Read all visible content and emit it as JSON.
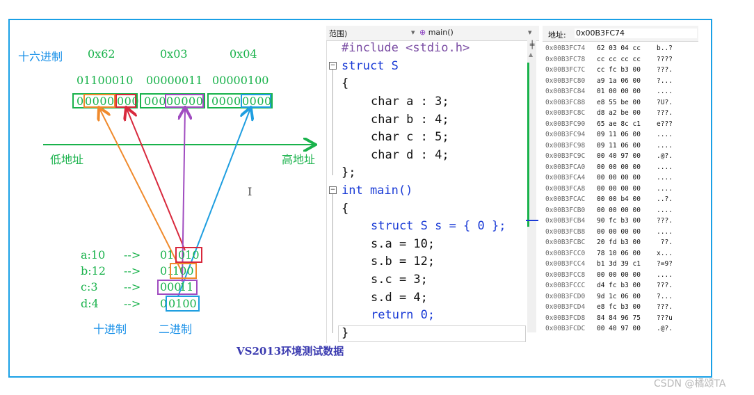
{
  "hex_label": "十六进制",
  "hex_values": [
    "0x62",
    "0x03",
    "0x04"
  ],
  "binary_bytes": [
    "01100010",
    "00000011",
    "00000100"
  ],
  "bit_groups": [
    {
      "a": "0",
      "b": "0000",
      "c": "000"
    },
    {
      "a": "000",
      "b": "00000"
    },
    {
      "a": "0000",
      "b": "0000"
    }
  ],
  "low_addr": "低地址",
  "high_addr": "高地址",
  "fields": [
    {
      "name": "a:10",
      "arrow": "-->",
      "pre": "01",
      "boxed": "010"
    },
    {
      "name": "b:12",
      "arrow": "-->",
      "pre": "01",
      "boxed": "100"
    },
    {
      "name": "c:3",
      "arrow": "-->",
      "pre": "000",
      "boxed": "11"
    },
    {
      "name": "d:4",
      "arrow": "-->",
      "pre": "0",
      "boxed": "0100"
    }
  ],
  "decimal_label": "十进制",
  "binary_label": "二进制",
  "caption": "VS2013环境测试数据",
  "cursor_glyph": "I",
  "editor": {
    "scope_dropdown": "范围)",
    "function_dropdown": "main()",
    "lines": [
      {
        "t": "#include <stdio.h>"
      },
      {
        "t": "struct S"
      },
      {
        "t": "{"
      },
      {
        "t": "char a : 3;"
      },
      {
        "t": "char b : 4;"
      },
      {
        "t": "char c : 5;"
      },
      {
        "t": "char d : 4;"
      },
      {
        "t": "};"
      },
      {
        "t": "int main()"
      },
      {
        "t": "{"
      },
      {
        "t": "struct S s = { 0 };"
      },
      {
        "t": "s.a = 10;"
      },
      {
        "t": "s.b = 12;"
      },
      {
        "t": "s.c = 3;"
      },
      {
        "t": "s.d = 4;"
      },
      {
        "t": "return 0;"
      },
      {
        "t": "}"
      }
    ]
  },
  "memory": {
    "address_label": "地址:",
    "address_value": "0x00B3FC74",
    "rows": [
      {
        "addr": "0x00B3FC74",
        "hex": "62 03 04 cc",
        "ascii": "b..?"
      },
      {
        "addr": "0x00B3FC78",
        "hex": "cc cc cc cc",
        "ascii": "????"
      },
      {
        "addr": "0x00B3FC7C",
        "hex": "cc fc b3 00",
        "ascii": "???."
      },
      {
        "addr": "0x00B3FC80",
        "hex": "a9 1a 06 00",
        "ascii": "?..."
      },
      {
        "addr": "0x00B3FC84",
        "hex": "01 00 00 00",
        "ascii": "...."
      },
      {
        "addr": "0x00B3FC88",
        "hex": "e8 55 be 00",
        "ascii": "?U?."
      },
      {
        "addr": "0x00B3FC8C",
        "hex": "d8 a2 be 00",
        "ascii": "???."
      },
      {
        "addr": "0x00B3FC90",
        "hex": "65 ae 8c c1",
        "ascii": "e???"
      },
      {
        "addr": "0x00B3FC94",
        "hex": "09 11 06 00",
        "ascii": "...."
      },
      {
        "addr": "0x00B3FC98",
        "hex": "09 11 06 00",
        "ascii": "...."
      },
      {
        "addr": "0x00B3FC9C",
        "hex": "00 40 97 00",
        "ascii": ".@?."
      },
      {
        "addr": "0x00B3FCA0",
        "hex": "00 00 00 00",
        "ascii": "...."
      },
      {
        "addr": "0x00B3FCA4",
        "hex": "00 00 00 00",
        "ascii": "...."
      },
      {
        "addr": "0x00B3FCA8",
        "hex": "00 00 00 00",
        "ascii": "...."
      },
      {
        "addr": "0x00B3FCAC",
        "hex": "00 00 b4 00",
        "ascii": "..?."
      },
      {
        "addr": "0x00B3FCB0",
        "hex": "00 00 00 00",
        "ascii": "...."
      },
      {
        "addr": "0x00B3FCB4",
        "hex": "90 fc b3 00",
        "ascii": "???."
      },
      {
        "addr": "0x00B3FCB8",
        "hex": "00 00 00 00",
        "ascii": "...."
      },
      {
        "addr": "0x00B3FCBC",
        "hex": "20 fd b3 00",
        "ascii": " ??."
      },
      {
        "addr": "0x00B3FCC0",
        "hex": "78 10 06 00",
        "ascii": "x..."
      },
      {
        "addr": "0x00B3FCC4",
        "hex": "b1 3d 39 c1",
        "ascii": "?=9?"
      },
      {
        "addr": "0x00B3FCC8",
        "hex": "00 00 00 00",
        "ascii": "...."
      },
      {
        "addr": "0x00B3FCCC",
        "hex": "d4 fc b3 00",
        "ascii": "???."
      },
      {
        "addr": "0x00B3FCD0",
        "hex": "9d 1c 06 00",
        "ascii": "?..."
      },
      {
        "addr": "0x00B3FCD4",
        "hex": "e8 fc b3 00",
        "ascii": "???."
      },
      {
        "addr": "0x00B3FCD8",
        "hex": "84 84 96 75",
        "ascii": "???u"
      },
      {
        "addr": "0x00B3FCDC",
        "hex": "00 40 97 00",
        "ascii": ".@?."
      }
    ]
  },
  "watermark": "CSDN @橘颂TA",
  "colors": {
    "frame": "#1aa0e6",
    "green": "#19b24b",
    "blue": "#1890e8",
    "orange": "#f08a2c",
    "red": "#d8283c",
    "purple": "#a04cc0",
    "cyan": "#1e9ee0"
  }
}
